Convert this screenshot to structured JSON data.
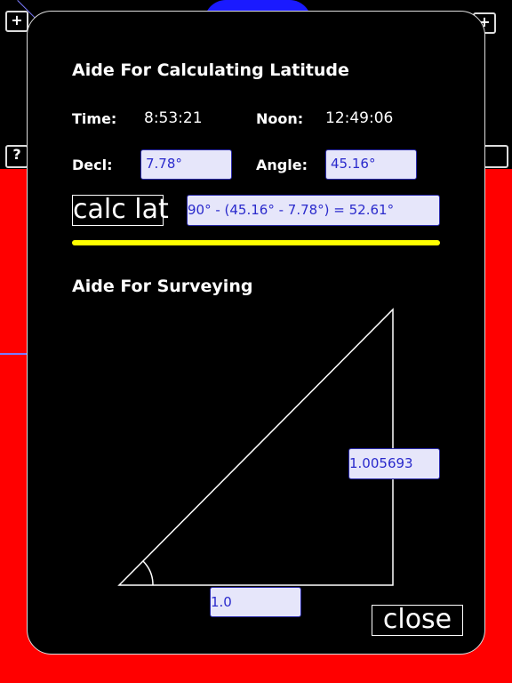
{
  "background": {
    "top_left_button": "+",
    "top_right_button": "+",
    "mid_left_button": "?",
    "colors": {
      "red": "#ff0000",
      "blue": "#1a1aff"
    }
  },
  "latitude": {
    "title": "Aide For Calculating Latitude",
    "time_label": "Time:",
    "time_value": "8:53:21",
    "noon_label": "Noon:",
    "noon_value": "12:49:06",
    "decl_label": "Decl:",
    "decl_value": "7.78°",
    "angle_label": "Angle:",
    "angle_value": "45.16°",
    "calc_button": "calc lat",
    "result": "90° - (45.16° -  7.78°) =  52.61°",
    "accent": "#ffff00"
  },
  "surveying": {
    "title": "Aide For Surveying",
    "height_value": "1.005693",
    "base_value": "1.0"
  },
  "close_button": "close"
}
